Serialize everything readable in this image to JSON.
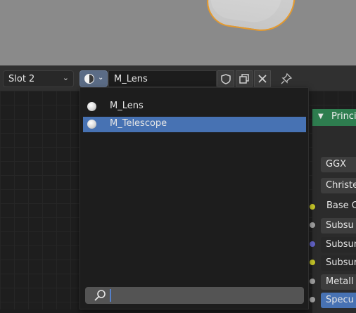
{
  "header": {
    "slot_label": "Slot 2",
    "material_name": "M_Lens"
  },
  "dropdown": {
    "items": [
      {
        "label": "M_Lens",
        "active": false
      },
      {
        "label": "M_Telescope",
        "active": true
      }
    ],
    "search_value": ""
  },
  "node": {
    "title": "Princi",
    "distribution": "GGX",
    "subsurface_method": "Christe",
    "rows": [
      {
        "label": "Base C",
        "type": "text",
        "socket_color": "#c7c729"
      },
      {
        "label": "Subsu",
        "type": "field",
        "socket_color": "#a1a1a1"
      },
      {
        "label": "Subsur",
        "type": "field-dark",
        "socket_color": "#6363c7"
      },
      {
        "label": "Subsur",
        "type": "field-dark",
        "socket_color": "#c7c729"
      },
      {
        "label": "Metall",
        "type": "field",
        "socket_color": "#a1a1a1"
      },
      {
        "label": "Specu",
        "type": "field-blue",
        "socket_color": "#a1a1a1"
      }
    ]
  },
  "colors": {
    "accent_blue": "#4772b3",
    "node_header_green": "#2e7d4f",
    "selection_outline_orange": "#e59a2e"
  },
  "icons": [
    "material-sphere-icon",
    "chevron-down-icon",
    "shield-icon",
    "duplicate-icon",
    "close-icon",
    "pin-icon",
    "search-icon"
  ]
}
